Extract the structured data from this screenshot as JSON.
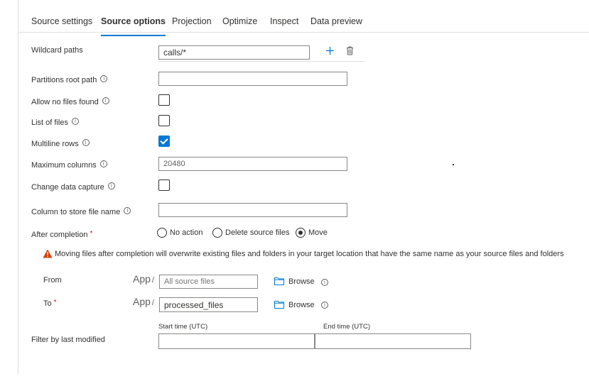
{
  "tabs": [
    "Source settings",
    "Source options",
    "Projection",
    "Optimize",
    "Inspect",
    "Data preview"
  ],
  "labels": {
    "wildcard_paths": "Wildcard paths",
    "partitions_root_path": "Partitions root path",
    "allow_no_files_found": "Allow no files found",
    "list_of_files": "List of files",
    "multiline_rows": "Multiline rows",
    "maximum_columns": "Maximum columns",
    "change_data_capture": "Change data capture",
    "column_to_store_file_name": "Column to store file name",
    "after_completion": "After completion",
    "from": "From",
    "to": "To",
    "filter_by_last_modified": "Filter by last modified"
  },
  "values": {
    "wildcard_path": "calls/*",
    "partitions_root_path": "",
    "maximum_columns": "20480",
    "column_to_store_file_name": "",
    "from_path": "",
    "from_placeholder": "All source files",
    "to_path": "processed_files",
    "start_time": "",
    "end_time": ""
  },
  "checkboxes": {
    "allow_no_files_found": false,
    "list_of_files": false,
    "multiline_rows": true,
    "change_data_capture": false
  },
  "after_completion": {
    "options": [
      "No action",
      "Delete source files",
      "Move"
    ],
    "selected": "Move"
  },
  "warning_text": "Moving files after completion will overwrite existing files and folders in your target location that have the same name as your source files and folders",
  "path_prefix": "App",
  "path_separator": "/",
  "browse_label": "Browse",
  "info_glyph": "i",
  "required_mark": "*",
  "time_headers": {
    "start": "Start time (UTC)",
    "end": "End time (UTC)"
  },
  "icons": {
    "add": "add-icon",
    "delete": "trash-icon",
    "info": "info-icon",
    "warning": "warning-icon",
    "folder": "folder-icon"
  },
  "colors": {
    "accent": "#0078d4",
    "warning": "#d83b01",
    "required": "#a4262c"
  }
}
